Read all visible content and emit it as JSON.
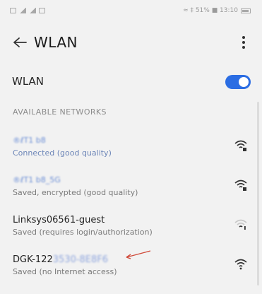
{
  "status_bar": {
    "right_text": "≈ ‡ 51% ■ 13:10"
  },
  "header": {
    "title": "WLAN"
  },
  "wlan_toggle": {
    "label": "WLAN",
    "enabled": true,
    "accent": "#2b6de3"
  },
  "section": {
    "available_label": "AVAILABLE NETWORKS"
  },
  "networks": [
    {
      "name": "®ℓT1 b8",
      "status": "Connected (good quality)",
      "icon": "wifi-locked-strong-icon"
    },
    {
      "name": "®ℓT1 b8_5G",
      "status": "Saved, encrypted (good quality)",
      "icon": "wifi-locked-strong-icon"
    },
    {
      "name": "Linksys06561-guest",
      "status": "Saved (requires login/authorization)",
      "icon": "wifi-weak-icon"
    },
    {
      "name": "DGK-122",
      "name_tail": "3530-8E8F6",
      "status": "Saved (no Internet access)",
      "icon": "wifi-strong-icon"
    }
  ]
}
